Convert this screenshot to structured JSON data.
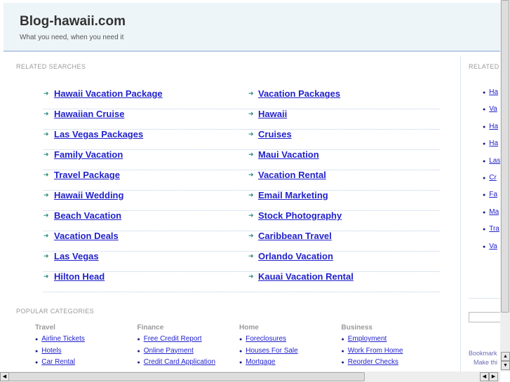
{
  "header": {
    "title": "Blog-hawaii.com",
    "tagline": "What you need, when you need it"
  },
  "related": {
    "heading": "RELATED SEARCHES",
    "left": [
      "Hawaii Vacation Package",
      "Hawaiian Cruise",
      "Las Vegas Packages",
      "Family Vacation",
      "Travel Package",
      "Hawaii Wedding",
      "Beach Vacation",
      "Vacation Deals",
      "Las Vegas",
      "Hilton Head"
    ],
    "right": [
      "Vacation Packages",
      "Hawaii",
      "Cruises",
      "Maui Vacation",
      "Vacation Rental",
      "Email Marketing",
      "Stock Photography",
      "Caribbean Travel",
      "Orlando Vacation",
      "Kauai Vacation Rental"
    ]
  },
  "popular": {
    "heading": "POPULAR CATEGORIES",
    "categories": [
      {
        "title": "Travel",
        "links": [
          "Airline Tickets",
          "Hotels",
          "Car Rental"
        ]
      },
      {
        "title": "Finance",
        "links": [
          "Free Credit Report",
          "Online Payment",
          "Credit Card Application"
        ]
      },
      {
        "title": "Home",
        "links": [
          "Foreclosures",
          "Houses For Sale",
          "Mortgage"
        ]
      },
      {
        "title": "Business",
        "links": [
          "Employment",
          "Work From Home",
          "Reorder Checks"
        ]
      }
    ]
  },
  "sidebar": {
    "heading": "RELATED",
    "items": [
      "Ha",
      "Va",
      "Ha",
      "Ha",
      "Las",
      "Cr",
      "Fa",
      "Ma",
      "Tra",
      "Va"
    ],
    "bookmark": "Bookmark",
    "make": "Make thi"
  },
  "colors": {
    "link": "#2222cc",
    "header_bg": "#eef5f8",
    "arrow": "#2a8a80"
  }
}
